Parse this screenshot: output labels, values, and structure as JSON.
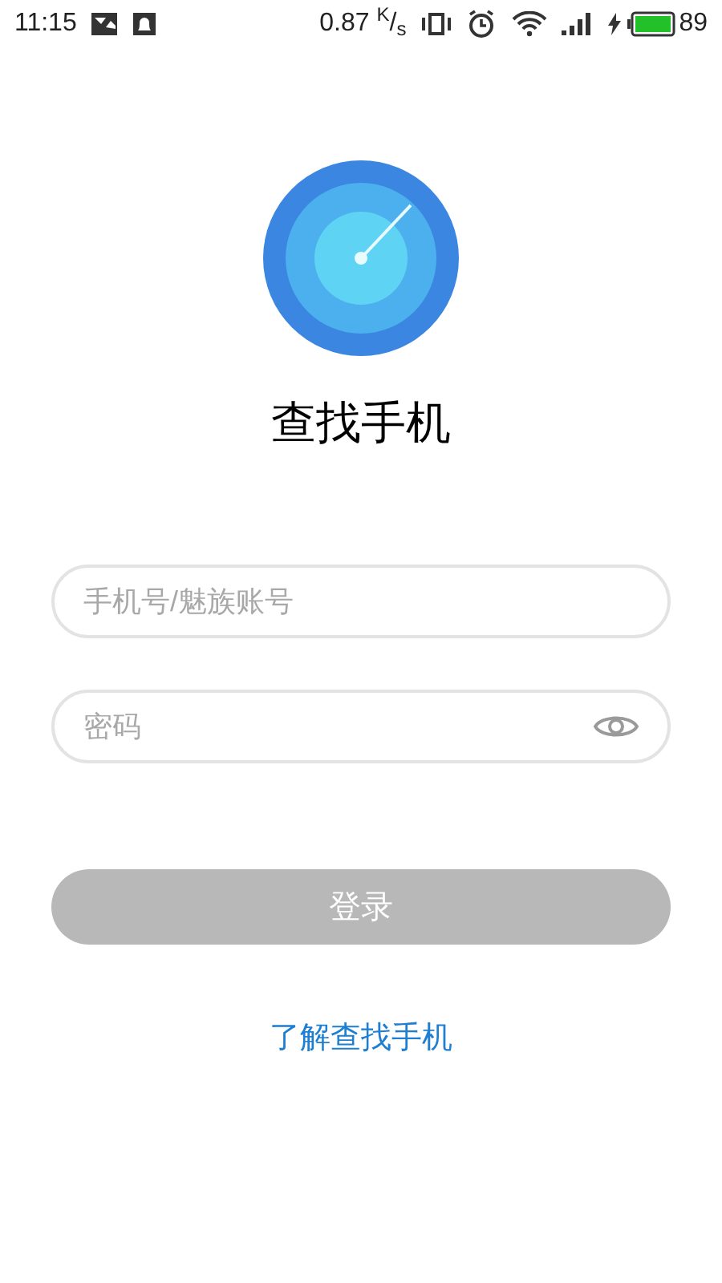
{
  "status_bar": {
    "time": "11:15",
    "speed": "0.87 $^{K}$/$_{s}$",
    "battery": "89"
  },
  "app_title": "查找手机",
  "fields": [
    {
      "placeholder": "手机号/魅族账号",
      "kind": "text"
    },
    {
      "placeholder": "密码",
      "kind": "password"
    }
  ],
  "login_button": {
    "label": "登录",
    "disabled": true
  },
  "link": "了解查找手机"
}
